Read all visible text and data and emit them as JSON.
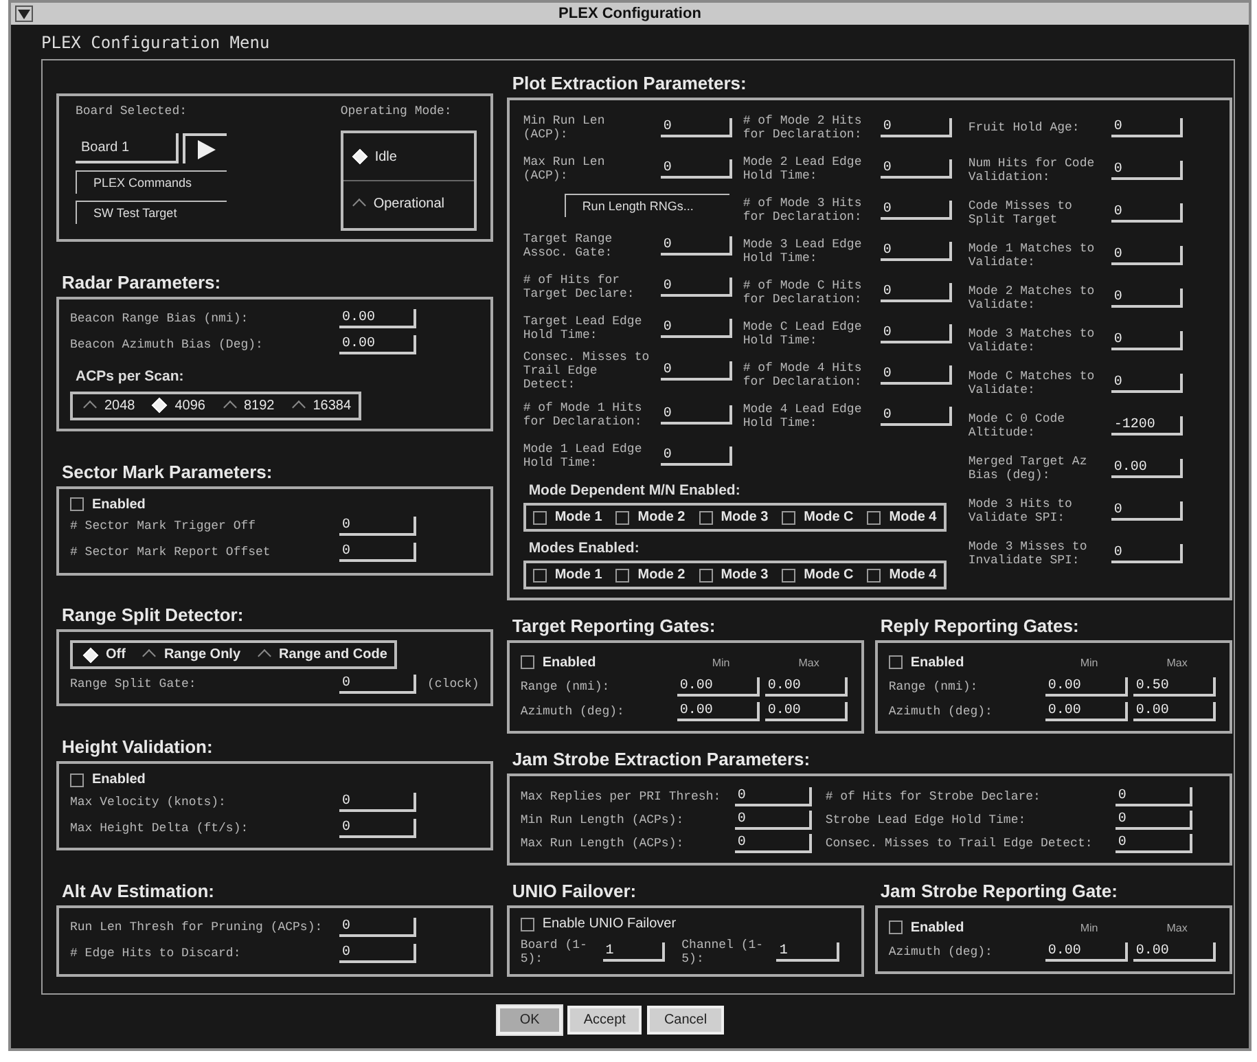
{
  "window": {
    "title": "PLEX Configuration"
  },
  "menu_title": "PLEX Configuration Menu",
  "board": {
    "label": "Board Selected:",
    "value": "Board 1",
    "buttons": [
      "PLEX Commands",
      "SW Test Target"
    ]
  },
  "operating_mode": {
    "label": "Operating Mode:",
    "options": [
      {
        "label": "Idle",
        "selected": true
      },
      {
        "label": "Operational",
        "selected": false
      }
    ]
  },
  "radar": {
    "title": "Radar Parameters:",
    "fields": [
      {
        "label": "Beacon Range Bias (nmi):",
        "value": "0.00"
      },
      {
        "label": "Beacon Azimuth Bias (Deg):",
        "value": "0.00"
      }
    ],
    "acps": {
      "label": "ACPs per Scan:",
      "options": [
        {
          "label": "2048",
          "selected": false
        },
        {
          "label": "4096",
          "selected": true
        },
        {
          "label": "8192",
          "selected": false
        },
        {
          "label": "16384",
          "selected": false
        }
      ]
    }
  },
  "sector_mark": {
    "title": "Sector Mark Parameters:",
    "enabled": {
      "label": "Enabled",
      "checked": false
    },
    "fields": [
      {
        "label": "# Sector Mark Trigger Off",
        "value": "0"
      },
      {
        "label": "# Sector Mark Report Offset",
        "value": "0"
      }
    ]
  },
  "range_split": {
    "title": "Range Split Detector:",
    "options": [
      {
        "label": "Off",
        "selected": true
      },
      {
        "label": "Range Only",
        "selected": false
      },
      {
        "label": "Range and Code",
        "selected": false
      }
    ],
    "field": {
      "label": "Range Split Gate:",
      "value": "0",
      "unit": "(clock)"
    }
  },
  "height_validation": {
    "title": "Height Validation:",
    "enabled": {
      "label": "Enabled",
      "checked": false
    },
    "fields": [
      {
        "label": "Max Velocity (knots):",
        "value": "0"
      },
      {
        "label": "Max Height Delta (ft/s):",
        "value": "0"
      }
    ]
  },
  "alt_av": {
    "title": "Alt Av Estimation:",
    "fields": [
      {
        "label": "Run Len Thresh for Pruning (ACPs):",
        "value": "0"
      },
      {
        "label": "# Edge Hits to Discard:",
        "value": "0"
      }
    ]
  },
  "plot_extraction": {
    "title": "Plot Extraction Parameters:",
    "column_1": [
      {
        "kind": "field",
        "label": "Min Run Len (ACP):",
        "value": "0"
      },
      {
        "kind": "field",
        "label": "Max Run Len (ACP):",
        "value": "0"
      },
      {
        "kind": "button",
        "label": "Run Length RNGs..."
      },
      {
        "kind": "field",
        "label": "Target Range Assoc. Gate:",
        "value": "0"
      },
      {
        "kind": "field",
        "label": "# of Hits for Target Declare:",
        "value": "0"
      },
      {
        "kind": "field",
        "label": "Target Lead Edge Hold Time:",
        "value": "0"
      },
      {
        "kind": "field",
        "label": "Consec. Misses to Trail Edge Detect:",
        "value": "0"
      },
      {
        "kind": "field",
        "label": "# of Mode 1 Hits for Declaration:",
        "value": "0"
      },
      {
        "kind": "field",
        "label": "Mode 1 Lead Edge Hold Time:",
        "value": "0"
      }
    ],
    "column_2": [
      {
        "label": "# of Mode 2 Hits for Declaration:",
        "value": "0"
      },
      {
        "label": "Mode 2 Lead Edge Hold Time:",
        "value": "0"
      },
      {
        "label": "# of Mode 3 Hits for Declaration:",
        "value": "0"
      },
      {
        "label": "Mode 3 Lead Edge Hold Time:",
        "value": "0"
      },
      {
        "label": "# of Mode C Hits for Declaration:",
        "value": "0"
      },
      {
        "label": "Mode C Lead Edge Hold Time:",
        "value": "0"
      },
      {
        "label": "# of Mode 4 Hits for Declaration:",
        "value": "0"
      },
      {
        "label": "Mode 4 Lead Edge Hold Time:",
        "value": "0"
      }
    ],
    "column_3": [
      {
        "label": "Fruit Hold Age:",
        "value": "0"
      },
      {
        "label": "Num Hits for Code Validation:",
        "value": "0"
      },
      {
        "label": "Code Misses to Split Target",
        "value": "0"
      },
      {
        "label": "Mode 1 Matches to Validate:",
        "value": "0"
      },
      {
        "label": "Mode 2 Matches to Validate:",
        "value": "0"
      },
      {
        "label": "Mode 3 Matches to Validate:",
        "value": "0"
      },
      {
        "label": "Mode C Matches to Validate:",
        "value": "0"
      },
      {
        "label": "Mode C 0 Code Altitude:",
        "value": "-1200"
      },
      {
        "label": "Merged Target Az Bias (deg):",
        "value": "0.00"
      },
      {
        "label": "Mode 3 Hits to Validate SPI:",
        "value": "0"
      },
      {
        "label": "Mode 3 Misses to Invalidate SPI:",
        "value": "0"
      }
    ],
    "mode_dependent": {
      "label": "Mode Dependent M/N Enabled:",
      "modes": [
        {
          "label": "Mode 1",
          "checked": false
        },
        {
          "label": "Mode 2",
          "checked": false
        },
        {
          "label": "Mode 3",
          "checked": false
        },
        {
          "label": "Mode C",
          "checked": false
        },
        {
          "label": "Mode 4",
          "checked": false
        }
      ]
    },
    "modes_enabled": {
      "label": "Modes Enabled:",
      "modes": [
        {
          "label": "Mode 1",
          "checked": false
        },
        {
          "label": "Mode 2",
          "checked": false
        },
        {
          "label": "Mode 3",
          "checked": false
        },
        {
          "label": "Mode C",
          "checked": false
        },
        {
          "label": "Mode 4",
          "checked": false
        }
      ]
    }
  },
  "target_gates": {
    "title": "Target Reporting Gates:",
    "enabled": {
      "label": "Enabled",
      "checked": false
    },
    "columns": [
      "Min",
      "Max"
    ],
    "rows": [
      {
        "label": "Range (nmi):",
        "min": "0.00",
        "max": "0.00"
      },
      {
        "label": "Azimuth (deg):",
        "min": "0.00",
        "max": "0.00"
      }
    ]
  },
  "reply_gates": {
    "title": "Reply Reporting Gates:",
    "enabled": {
      "label": "Enabled",
      "checked": false
    },
    "columns": [
      "Min",
      "Max"
    ],
    "rows": [
      {
        "label": "Range (nmi):",
        "min": "0.00",
        "max": "0.50"
      },
      {
        "label": "Azimuth (deg):",
        "min": "0.00",
        "max": "0.00"
      }
    ]
  },
  "jam_strobe": {
    "title": "Jam Strobe Extraction Parameters:",
    "left": [
      {
        "label": "Max Replies per PRI Thresh:",
        "value": "0"
      },
      {
        "label": "Min Run Length (ACPs):",
        "value": "0"
      },
      {
        "label": "Max Run Length (ACPs):",
        "value": "0"
      }
    ],
    "right": [
      {
        "label": "# of Hits for Strobe Declare:",
        "value": "0"
      },
      {
        "label": "Strobe Lead Edge Hold Time:",
        "value": "0"
      },
      {
        "label": "Consec. Misses to Trail Edge Detect:",
        "value": "0"
      }
    ]
  },
  "unio_failover": {
    "title": "UNIO Failover:",
    "enable": {
      "label": "Enable UNIO Failover",
      "checked": false
    },
    "fields": [
      {
        "label": "Board (1-5):",
        "value": "1"
      },
      {
        "label": "Channel (1-5):",
        "value": "1"
      }
    ]
  },
  "jam_gate": {
    "title": "Jam Strobe Reporting Gate:",
    "enabled": {
      "label": "Enabled",
      "checked": false
    },
    "columns": [
      "Min",
      "Max"
    ],
    "rows": [
      {
        "label": "Azimuth (deg):",
        "min": "0.00",
        "max": "0.00"
      }
    ]
  },
  "buttons": [
    "OK",
    "Accept",
    "Cancel"
  ]
}
